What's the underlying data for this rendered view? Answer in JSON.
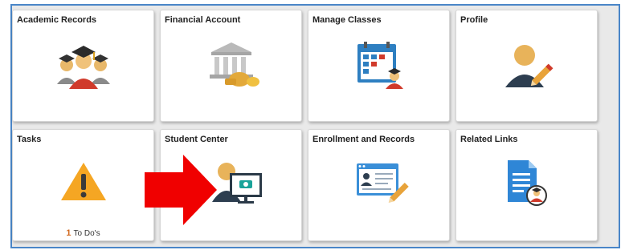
{
  "tiles": [
    {
      "id": "academic-records",
      "title": "Academic Records",
      "icon": "graduates-icon"
    },
    {
      "id": "financial-account",
      "title": "Financial Account",
      "icon": "bank-icon"
    },
    {
      "id": "manage-classes",
      "title": "Manage Classes",
      "icon": "calendar-icon"
    },
    {
      "id": "profile",
      "title": "Profile",
      "icon": "profile-edit-icon"
    },
    {
      "id": "tasks",
      "title": "Tasks",
      "icon": "warning-icon",
      "todo_count": "1",
      "todo_label": "To Do's"
    },
    {
      "id": "student-center",
      "title": "Student Center",
      "icon": "student-center-icon"
    },
    {
      "id": "enrollment-records",
      "title": "Enrollment and Records",
      "icon": "id-card-icon"
    },
    {
      "id": "related-links",
      "title": "Related Links",
      "icon": "document-user-icon"
    }
  ],
  "annotation": {
    "icon": "red-arrow-icon",
    "color": "#f00000",
    "points_to": "Student Center"
  },
  "colors": {
    "frame_border": "#4a86c8",
    "background": "#e9e9e9",
    "tile": "#ffffff"
  }
}
